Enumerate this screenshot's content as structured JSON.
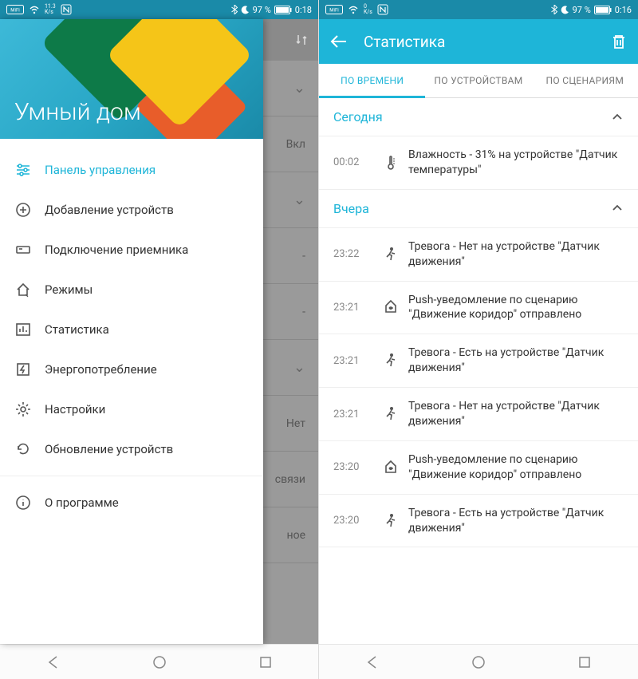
{
  "left": {
    "status": {
      "speed": "11.3",
      "speed_unit": "K/s",
      "battery": "97 %",
      "time": "0:18"
    },
    "drawer_title": "Умный дом",
    "menu": [
      {
        "label": "Панель управления",
        "icon": "sliders",
        "active": true
      },
      {
        "label": "Добавление устройств",
        "icon": "plus-circle"
      },
      {
        "label": "Подключение приемника",
        "icon": "receiver"
      },
      {
        "label": "Режимы",
        "icon": "home-mode"
      },
      {
        "label": "Статистика",
        "icon": "bar-chart"
      },
      {
        "label": "Энергопотребление",
        "icon": "energy"
      },
      {
        "label": "Настройки",
        "icon": "gear"
      },
      {
        "label": "Обновление устройств",
        "icon": "refresh"
      }
    ],
    "about_label": "О программе",
    "bg_rows": [
      "",
      "Вкл",
      "",
      "-",
      "-",
      "",
      "Нет",
      "связи",
      "ное"
    ]
  },
  "right": {
    "status": {
      "speed": "0",
      "speed_unit": "K/s",
      "battery": "97 %",
      "time": "0:16"
    },
    "app_title": "Статистика",
    "tabs": [
      "ПО ВРЕМЕНИ",
      "ПО УСТРОЙСТВАМ",
      "ПО СЦЕНАРИЯМ"
    ],
    "sections": [
      {
        "title": "Сегодня",
        "entries": [
          {
            "time": "00:02",
            "icon": "thermo",
            "text": "Влажность - 31%  на устройстве \"Датчик температуры\""
          }
        ]
      },
      {
        "title": "Вчера",
        "entries": [
          {
            "time": "23:22",
            "icon": "motion",
            "text": "Тревога - Нет  на устройстве \"Датчик движения\""
          },
          {
            "time": "23:21",
            "icon": "bell",
            "text": "Push-уведомление по сценарию \"Движение коридор\" отправлено"
          },
          {
            "time": "23:21",
            "icon": "motion",
            "text": "Тревога - Есть  на устройстве \"Датчик движения\""
          },
          {
            "time": "23:21",
            "icon": "motion",
            "text": "Тревога - Нет  на устройстве \"Датчик движения\""
          },
          {
            "time": "23:20",
            "icon": "bell",
            "text": "Push-уведомление по сценарию \"Движение коридор\" отправлено"
          },
          {
            "time": "23:20",
            "icon": "motion",
            "text": "Тревога - Есть  на устройстве \"Датчик движения\""
          }
        ]
      }
    ]
  }
}
